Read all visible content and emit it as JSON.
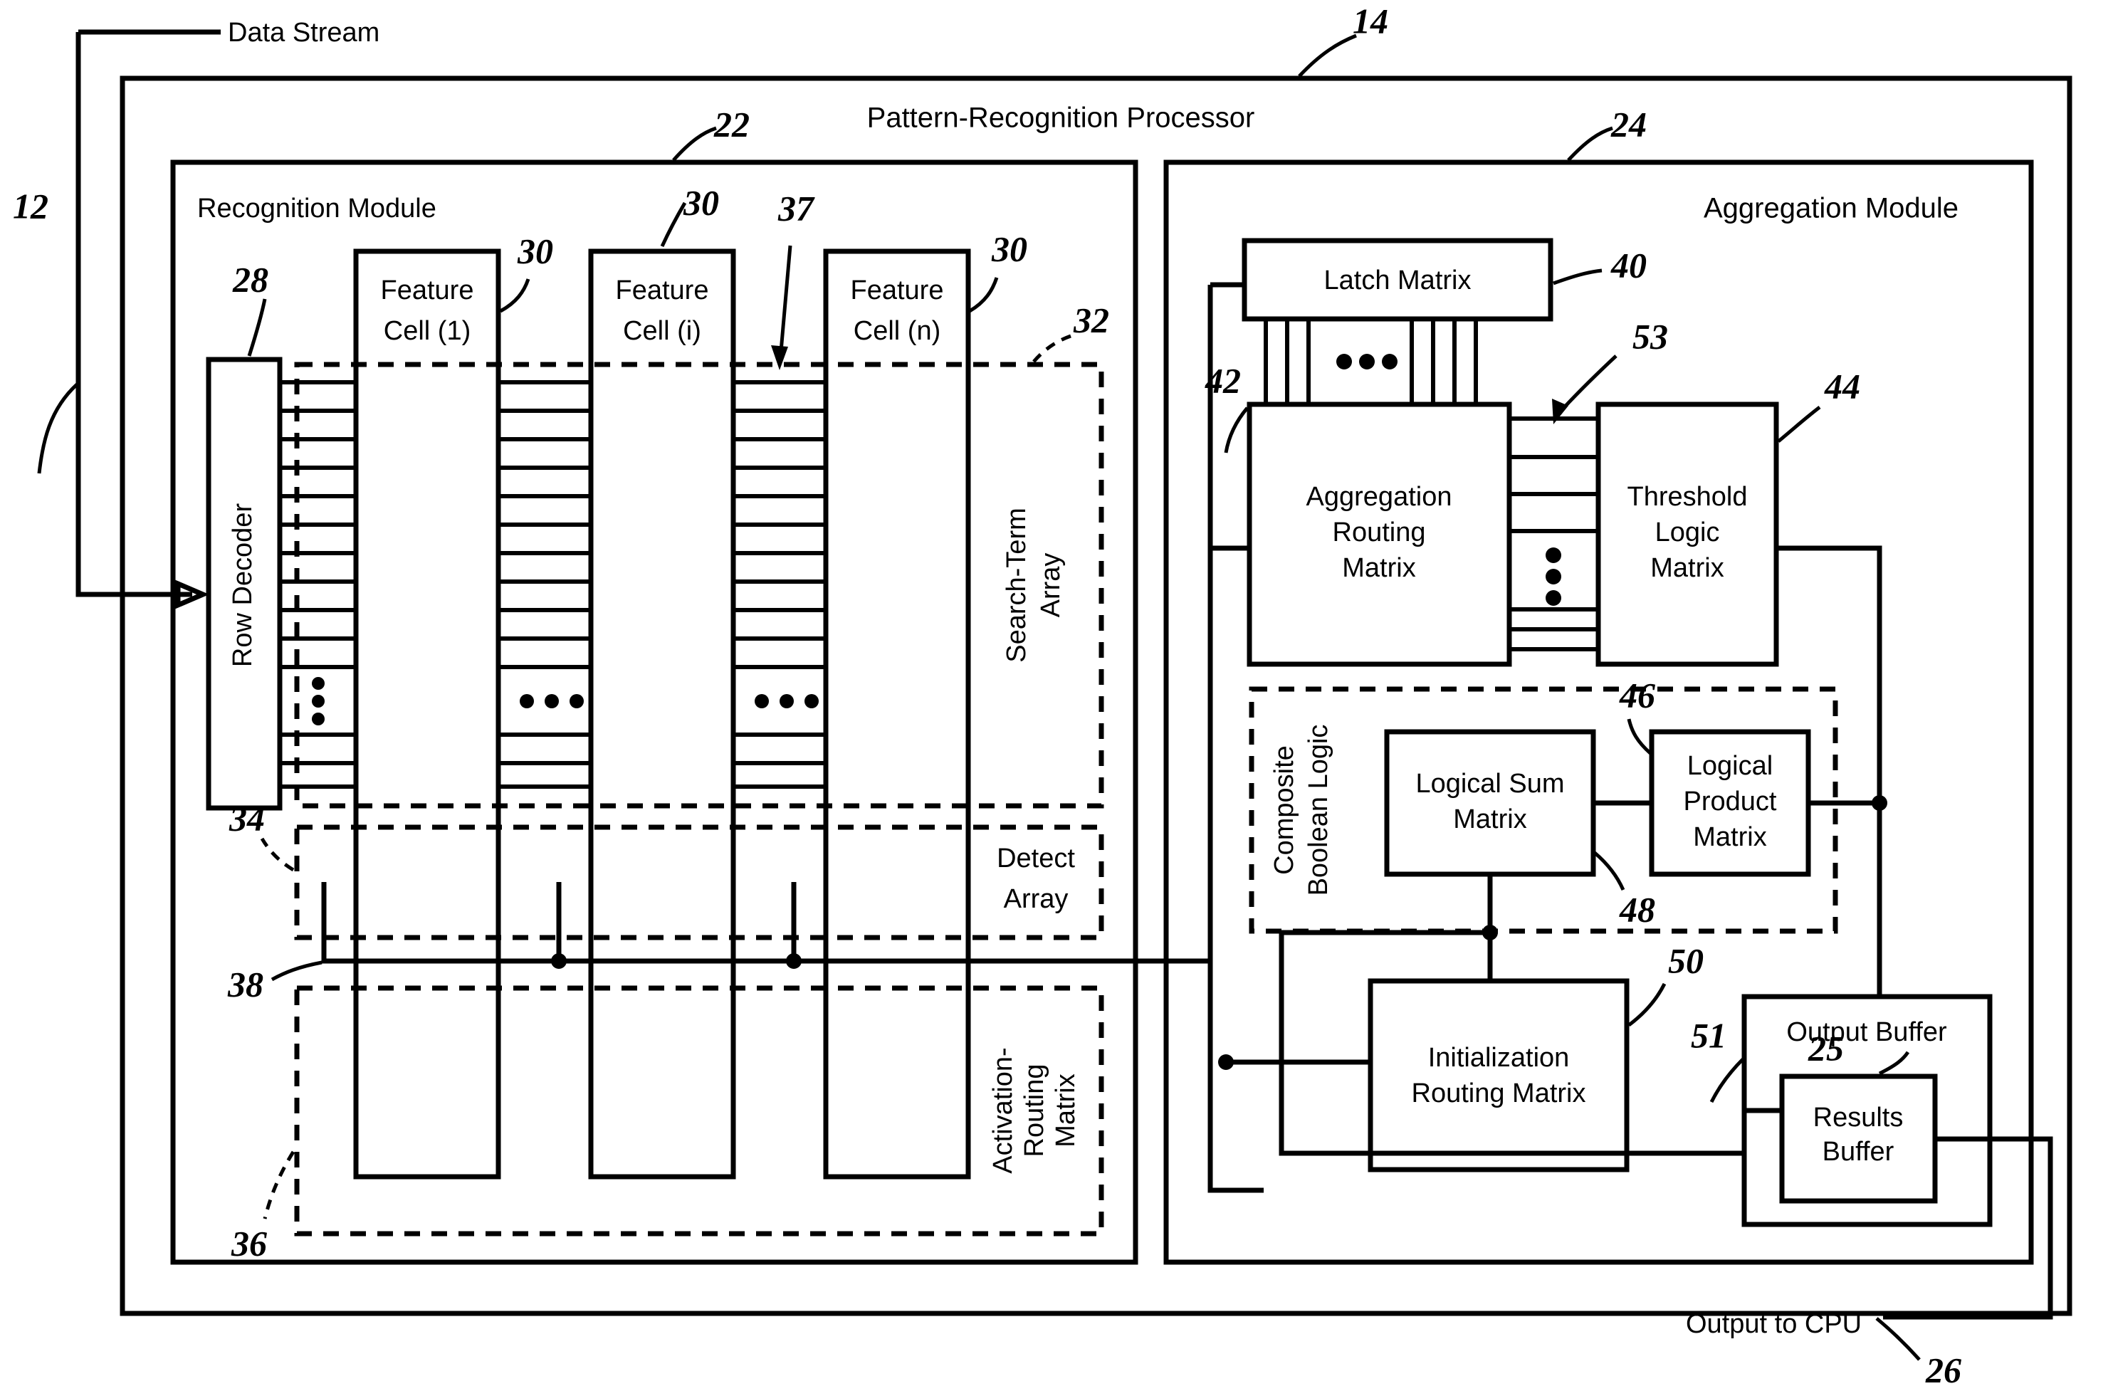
{
  "figure": {
    "kind": "patent-block-diagram",
    "stroke_color": "#000000",
    "background_color": "#ffffff"
  },
  "external_labels": {
    "data_stream": "Data Stream",
    "output_to_cpu": "Output to CPU"
  },
  "outer": {
    "title": "Pattern-Recognition Processor",
    "ref": "14"
  },
  "refs": {
    "data_stream_bus": "12",
    "processor": "14",
    "recognition_module": "22",
    "aggregation_module": "24",
    "results_buffer": "25",
    "output_bus": "26",
    "row_decoder": "28",
    "feature_cell": "30",
    "search_term_array": "32",
    "detect_array": "34",
    "activation_routing_matrix": "36",
    "search_term_row": "37",
    "detect_line": "38",
    "latch_matrix": "40",
    "aggregation_routing_matrix": "42",
    "threshold_logic_matrix": "44",
    "logical_product_matrix": "46",
    "logical_sum_matrix": "48",
    "initialization_routing_matrix": "50",
    "output_buffer": "51",
    "threshold_bus": "53"
  },
  "recognition_module": {
    "title": "Recognition Module",
    "ref": "22",
    "row_decoder": {
      "label": "Row Decoder",
      "ref": "28"
    },
    "feature_cells": [
      {
        "label_line1": "Feature",
        "label_line2": "Cell (1)",
        "ref": "30"
      },
      {
        "label_line1": "Feature",
        "label_line2": "Cell (i)",
        "ref": "30"
      },
      {
        "label_line1": "Feature",
        "label_line2": "Cell (n)",
        "ref": "30"
      }
    ],
    "search_term_array": {
      "label_line1": "Search-Term",
      "label_line2": "Array",
      "ref": "32"
    },
    "detect_array": {
      "label_line1": "Detect",
      "label_line2": "Array",
      "ref": "34"
    },
    "activation_routing_matrix": {
      "label_line1": "Activation-",
      "label_line2": "Routing",
      "label_line3": "Matrix",
      "ref": "36"
    },
    "ellipsis": "• • •"
  },
  "aggregation_module": {
    "title": "Aggregation Module",
    "ref": "24",
    "latch_matrix": {
      "label": "Latch Matrix",
      "ref": "40"
    },
    "aggregation_routing_matrix": {
      "label_line1": "Aggregation",
      "label_line2": "Routing",
      "label_line3": "Matrix",
      "ref": "42"
    },
    "threshold_logic_matrix": {
      "label_line1": "Threshold",
      "label_line2": "Logic",
      "label_line3": "Matrix",
      "ref": "44"
    },
    "composite_boolean_logic": {
      "label_line1": "Composite",
      "label_line2": "Boolean Logic"
    },
    "logical_sum_matrix": {
      "label_line1": "Logical Sum",
      "label_line2": "Matrix",
      "ref": "48"
    },
    "logical_product_matrix": {
      "label_line1": "Logical",
      "label_line2": "Product",
      "label_line3": "Matrix",
      "ref": "46"
    },
    "initialization_routing_matrix": {
      "label_line1": "Initialization",
      "label_line2": "Routing Matrix",
      "ref": "50"
    },
    "output_buffer": {
      "label": "Output Buffer",
      "ref": "51"
    },
    "results_buffer": {
      "label_line1": "Results",
      "label_line2": "Buffer",
      "ref": "25"
    }
  }
}
